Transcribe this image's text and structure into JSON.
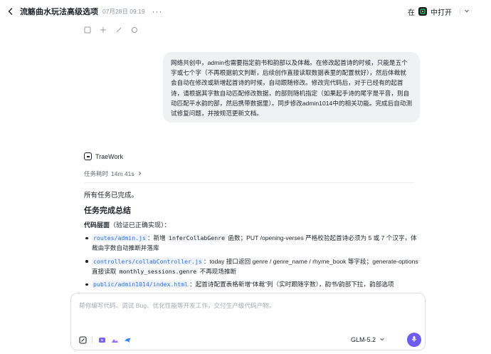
{
  "header": {
    "title": "流觞曲水玩法高级选项",
    "date": "07月28日 09:19",
    "open_prefix": "在",
    "open_label": "中打开"
  },
  "user_message": "网络共创中，admin也需要指定韵书和韵部以及体裁。在修改起首诗的时候，只能是五个字或七个字（不再根据前文判断，后续创作直接读取数据表里的配置就好），然后体裁就会自动在修改或新增起首诗的时候，自动跟随修改。修改完代码后，对于已经有的起首诗，请根据其字数自动匹配修改数据，的部则随机指定（如果起手诗的尾字是平音，则自动匹配平水韵的部，然后携带数据里）。同步修改admin1014中的相关功能。完成后自动测试修复问题，并按规范更新文档。",
  "assistant": {
    "name": "TraeWork",
    "task_time_label": "任务耗时",
    "task_time_value": "14m 41s",
    "done": "所有任务已完成。",
    "summary_title": "任务完成总结",
    "code_layer_label": "代码层面",
    "code_layer_note": "（验证已正确实现）：",
    "bullets": [
      {
        "path": "routes/admin.js",
        "pre": "：新增 ",
        "code": "inferCollabGenre",
        "post": " 函数；PUT /opening-verses 严格校验起首诗必须为 5 或 7 个汉字，体裁由字数自动推断并落库"
      },
      {
        "path": "controllers/collabController.js",
        "pre": "：today 接口返回 genre / genre_name / rhyme_book 等字段；generate-options 直接读取 ",
        "code": "monthly_sessions.genre",
        "post": " 不再现场推断"
      },
      {
        "path": "public/admin1014/index.html",
        "pre": "：起首诗配置表格新增“体裁”列（实时跟随字数），韵书/韵部下拉，韵部选项",
        "code": "",
        "post": ""
      }
    ]
  },
  "input": {
    "placeholder": "帮你编写代码、调试 Bug、优化性能等开发工作，交付生产级代码产物。",
    "model": "GLM-5.2"
  },
  "icons": {
    "back": "back-arrow-icon",
    "more": "more-icon",
    "app": "app-icon",
    "send": "microphone-icon"
  },
  "colors": {
    "accent": "#6f5cf1",
    "link": "#2f6fde",
    "bubble": "#f0f1f3"
  }
}
